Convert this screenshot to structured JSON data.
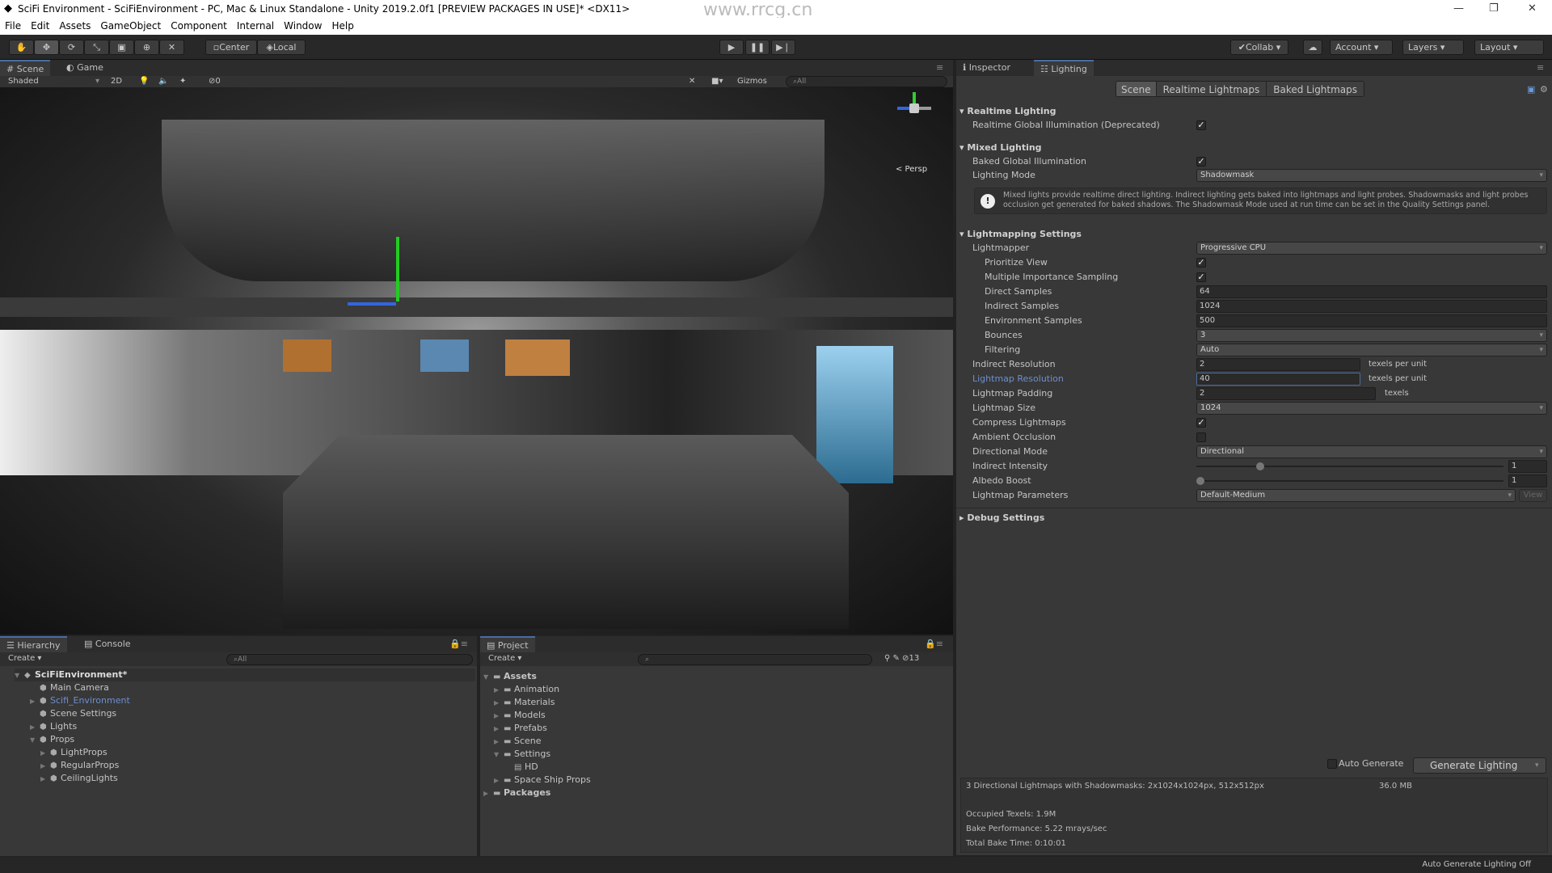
{
  "window": {
    "title": "SciFi Environment - SciFiEnvironment - PC, Mac & Linux Standalone - Unity 2019.2.0f1 [PREVIEW PACKAGES IN USE]* <DX11>",
    "watermark": "www.rrcg.cn"
  },
  "menu": [
    "File",
    "Edit",
    "Assets",
    "GameObject",
    "Component",
    "Internal",
    "Window",
    "Help"
  ],
  "toolbar": {
    "tools": [
      "hand-icon",
      "move-icon",
      "rotate-icon",
      "scale-icon",
      "rect-icon",
      "transform-icon",
      "custom-icon"
    ],
    "pivot": "Center",
    "space": "Local",
    "collab": "Collab",
    "account": "Account",
    "layers": "Layers",
    "layout": "Layout"
  },
  "scene": {
    "tabs": [
      "Scene",
      "Game"
    ],
    "shading": "Shaded",
    "mode2d": "2D",
    "hidden_count": "0",
    "gizmos": "Gizmos",
    "search": "All",
    "persp": "< Persp"
  },
  "hierarchy": {
    "tabs": [
      "Hierarchy",
      "Console"
    ],
    "create": "Create",
    "search": "All",
    "root": "SciFiEnvironment*",
    "items": [
      {
        "label": "Main Camera",
        "depth": 1,
        "expand": ""
      },
      {
        "label": "Scifi_Environment",
        "depth": 1,
        "expand": "▶",
        "selected": true
      },
      {
        "label": "Scene Settings",
        "depth": 1,
        "expand": ""
      },
      {
        "label": "Lights",
        "depth": 1,
        "expand": "▶"
      },
      {
        "label": "Props",
        "depth": 1,
        "expand": "▼"
      },
      {
        "label": "LightProps",
        "depth": 2,
        "expand": "▶"
      },
      {
        "label": "RegularProps",
        "depth": 2,
        "expand": "▶"
      },
      {
        "label": "CeilingLights",
        "depth": 2,
        "expand": "▶"
      }
    ]
  },
  "project": {
    "tab": "Project",
    "create": "Create",
    "hidden_count": "13",
    "items": [
      {
        "label": "Assets",
        "depth": 0,
        "expand": "▼",
        "bold": true
      },
      {
        "label": "Animation",
        "depth": 1,
        "expand": "▶"
      },
      {
        "label": "Materials",
        "depth": 1,
        "expand": "▶"
      },
      {
        "label": "Models",
        "depth": 1,
        "expand": "▶"
      },
      {
        "label": "Prefabs",
        "depth": 1,
        "expand": "▶"
      },
      {
        "label": "Scene",
        "depth": 1,
        "expand": "▶"
      },
      {
        "label": "Settings",
        "depth": 1,
        "expand": "▼"
      },
      {
        "label": "HD",
        "depth": 2,
        "expand": "",
        "file": true
      },
      {
        "label": "Space Ship Props",
        "depth": 1,
        "expand": "▶"
      },
      {
        "label": "Packages",
        "depth": 0,
        "expand": "▶",
        "bold": true
      }
    ]
  },
  "inspector": {
    "tabs": [
      "Inspector",
      "Lighting"
    ],
    "subtabs": [
      "Scene",
      "Realtime Lightmaps",
      "Baked Lightmaps"
    ],
    "realtime": {
      "header": "Realtime Lighting",
      "rgi_label": "Realtime Global Illumination (Deprecated)",
      "rgi": true
    },
    "mixed": {
      "header": "Mixed Lighting",
      "bgi_label": "Baked Global Illumination",
      "bgi": true,
      "mode_label": "Lighting Mode",
      "mode": "Shadowmask",
      "help": "Mixed lights provide realtime direct lighting. Indirect lighting gets baked into lightmaps and light probes. Shadowmasks and light probes occlusion get generated for baked shadows. The Shadowmask Mode used at run time can be set in the Quality Settings panel."
    },
    "lightmapping": {
      "header": "Lightmapping Settings",
      "lightmapper_label": "Lightmapper",
      "lightmapper": "Progressive CPU",
      "prioritize_label": "Prioritize View",
      "prioritize": true,
      "mis_label": "Multiple Importance Sampling",
      "mis": true,
      "direct_label": "Direct Samples",
      "direct": "64",
      "indirect_label": "Indirect Samples",
      "indirect": "1024",
      "env_label": "Environment Samples",
      "env": "500",
      "bounces_label": "Bounces",
      "bounces": "3",
      "filtering_label": "Filtering",
      "filtering": "Auto",
      "indres_label": "Indirect Resolution",
      "indres": "2",
      "lmres_label": "Lightmap Resolution",
      "lmres": "40",
      "texels_per_unit": "texels per unit",
      "padding_label": "Lightmap Padding",
      "padding": "2",
      "texels": "texels",
      "size_label": "Lightmap Size",
      "size": "1024",
      "compress_label": "Compress Lightmaps",
      "compress": true,
      "ao_label": "Ambient Occlusion",
      "ao": false,
      "dirmode_label": "Directional Mode",
      "dirmode": "Directional",
      "intensity_label": "Indirect Intensity",
      "intensity": "1",
      "intensity_fraction": 0.2,
      "albedo_label": "Albedo Boost",
      "albedo": "1",
      "albedo_fraction": 0.0,
      "params_label": "Lightmap Parameters",
      "params": "Default-Medium",
      "view": "View"
    },
    "debug": {
      "header": "Debug Settings"
    },
    "auto_generate_label": "Auto Generate",
    "auto_generate": false,
    "generate": "Generate Lighting",
    "stats": {
      "summary": "3 Directional Lightmaps with Shadowmasks: 2x1024x1024px, 512x512px",
      "size": "36.0 MB",
      "occupied": "Occupied Texels: 1.9M",
      "performance": "Bake Performance: 5.22 mrays/sec",
      "time": "Total Bake Time: 0:10:01"
    }
  },
  "status": "Auto Generate Lighting Off",
  "colors": {
    "accent": "#4a6da0",
    "selected_text": "#6b8fd0",
    "panel": "#383838"
  }
}
